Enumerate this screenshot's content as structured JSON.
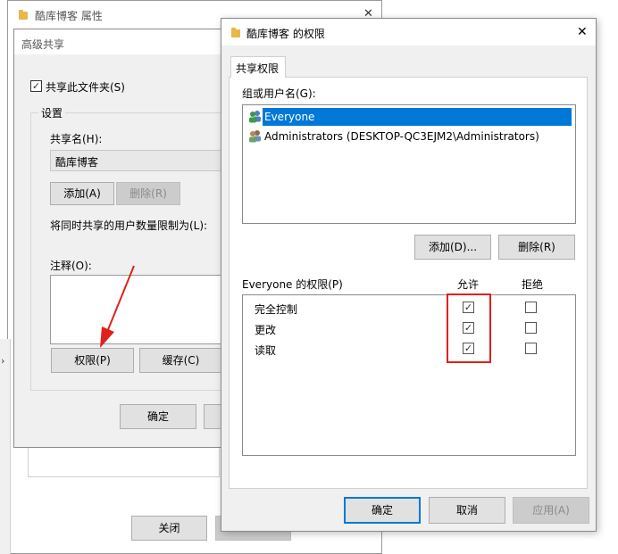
{
  "background_window": {
    "title": "酷库博客 属性",
    "close_glyph": "✕",
    "close_button_label": "关闭"
  },
  "advanced_dialog": {
    "title": "高级共享",
    "share_checkbox_label": "共享此文件夹(S)",
    "share_checked": true,
    "settings_group_label": "设置",
    "share_name_label": "共享名(H):",
    "share_name_value": "酷库博客",
    "add_button": "添加(A)",
    "remove_button": "删除(R)",
    "user_limit_label": "将同时共享的用户数量限制为(L):",
    "comment_label": "注释(O):",
    "permissions_button": "权限(P)",
    "cache_button": "缓存(C)",
    "ok_button": "确定"
  },
  "permissions_dialog": {
    "title": "酷库博客 的权限",
    "close_glyph": "✕",
    "tab_label": "共享权限",
    "group_label": "组或用户名(G):",
    "users": [
      {
        "name": "Everyone",
        "selected": true
      },
      {
        "name": "Administrators (DESKTOP-QC3EJM2\\Administrators)",
        "selected": false
      }
    ],
    "add_button": "添加(D)...",
    "remove_button": "删除(R)",
    "perm_header": "Everyone 的权限(P)",
    "allow_header": "允许",
    "deny_header": "拒绝",
    "permissions": [
      {
        "name": "完全控制",
        "allow": true,
        "deny": false
      },
      {
        "name": "更改",
        "allow": true,
        "deny": false
      },
      {
        "name": "读取",
        "allow": true,
        "deny": false
      }
    ],
    "ok_button": "确定",
    "cancel_button": "取消",
    "apply_button": "应用(A)",
    "highlight_color": "#e0201b",
    "selection_color": "#0078d7"
  }
}
